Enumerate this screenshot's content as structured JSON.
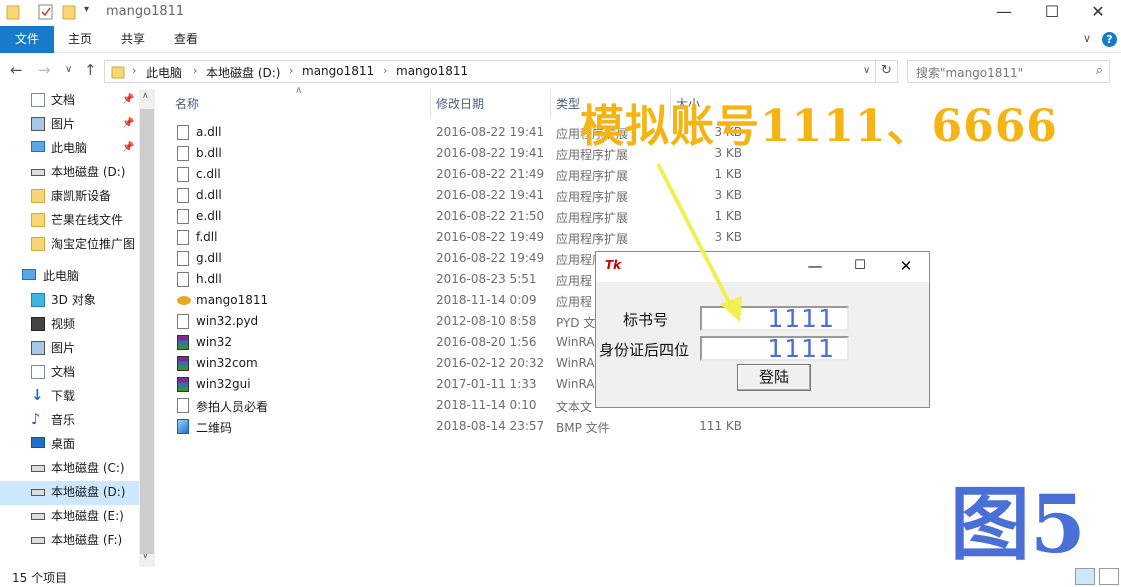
{
  "window": {
    "title": "mango1811"
  },
  "ribbon": {
    "tabs": [
      "文件",
      "主页",
      "共享",
      "查看"
    ]
  },
  "address": {
    "crumbs": [
      "此电脑",
      "本地磁盘 (D:)",
      "mango1811",
      "mango1811"
    ],
    "search_placeholder": "搜索\"mango1811\""
  },
  "nav": {
    "quick": [
      {
        "label": "文档",
        "icon": "document-icon",
        "pinned": true
      },
      {
        "label": "图片",
        "icon": "pictures-icon",
        "pinned": true
      },
      {
        "label": "此电脑",
        "icon": "computer-icon",
        "pinned": true
      },
      {
        "label": "本地磁盘 (D:)",
        "icon": "drive-icon",
        "pinned": false
      },
      {
        "label": "康凯斯设备",
        "icon": "folder-icon",
        "pinned": false
      },
      {
        "label": "芒果在线文件",
        "icon": "folder-icon",
        "pinned": false
      },
      {
        "label": "淘宝定位推广图",
        "icon": "folder-icon",
        "pinned": false
      }
    ],
    "this_pc": "此电脑",
    "pc_items": [
      {
        "label": "3D 对象",
        "icon": "3d-objects-icon"
      },
      {
        "label": "视频",
        "icon": "video-icon"
      },
      {
        "label": "图片",
        "icon": "pictures-icon"
      },
      {
        "label": "文档",
        "icon": "document-icon"
      },
      {
        "label": "下载",
        "icon": "download-icon"
      },
      {
        "label": "音乐",
        "icon": "music-icon"
      },
      {
        "label": "桌面",
        "icon": "desktop-icon"
      },
      {
        "label": "本地磁盘 (C:)",
        "icon": "drive-icon"
      },
      {
        "label": "本地磁盘 (D:)",
        "icon": "drive-icon",
        "selected": true
      },
      {
        "label": "本地磁盘 (E:)",
        "icon": "drive-icon"
      },
      {
        "label": "本地磁盘 (F:)",
        "icon": "drive-icon"
      }
    ]
  },
  "columns": {
    "name": "名称",
    "modified": "修改日期",
    "type": "类型",
    "size": "大小"
  },
  "files": [
    {
      "name": "a.dll",
      "date": "2016-08-22 19:41",
      "type": "应用程序扩展",
      "size": "3 KB",
      "icon": "dll-file-icon"
    },
    {
      "name": "b.dll",
      "date": "2016-08-22 19:41",
      "type": "应用程序扩展",
      "size": "3 KB",
      "icon": "dll-file-icon"
    },
    {
      "name": "c.dll",
      "date": "2016-08-22 21:49",
      "type": "应用程序扩展",
      "size": "1 KB",
      "icon": "dll-file-icon"
    },
    {
      "name": "d.dll",
      "date": "2016-08-22 19:41",
      "type": "应用程序扩展",
      "size": "3 KB",
      "icon": "dll-file-icon"
    },
    {
      "name": "e.dll",
      "date": "2016-08-22 21:50",
      "type": "应用程序扩展",
      "size": "1 KB",
      "icon": "dll-file-icon"
    },
    {
      "name": "f.dll",
      "date": "2016-08-22 19:49",
      "type": "应用程序扩展",
      "size": "3 KB",
      "icon": "dll-file-icon"
    },
    {
      "name": "g.dll",
      "date": "2016-08-22 19:49",
      "type": "应用程序扩展",
      "size": "",
      "icon": "dll-file-icon"
    },
    {
      "name": "h.dll",
      "date": "2016-08-23 5:51",
      "type": "应用程",
      "size": "",
      "icon": "dll-file-icon"
    },
    {
      "name": "mango1811",
      "date": "2018-11-14 0:09",
      "type": "应用程",
      "size": "",
      "icon": "mango-app-icon"
    },
    {
      "name": "win32.pyd",
      "date": "2012-08-10 8:58",
      "type": "PYD 文",
      "size": "",
      "icon": "file-icon"
    },
    {
      "name": "win32",
      "date": "2016-08-20 1:56",
      "type": "WinRA",
      "size": "",
      "icon": "winrar-archive-icon"
    },
    {
      "name": "win32com",
      "date": "2016-02-12 20:32",
      "type": "WinRA",
      "size": "",
      "icon": "winrar-archive-icon"
    },
    {
      "name": "win32gui",
      "date": "2017-01-11 1:33",
      "type": "WinRA",
      "size": "",
      "icon": "winrar-archive-icon"
    },
    {
      "name": "参拍人员必看",
      "date": "2018-11-14 0:10",
      "type": "文本文",
      "size": "",
      "icon": "text-file-icon"
    },
    {
      "name": "二维码",
      "date": "2018-08-14 23:57",
      "type": "BMP 文件",
      "size": "111 KB",
      "icon": "bmp-file-icon"
    }
  ],
  "status": {
    "item_count": "15 个项目"
  },
  "dialog": {
    "icon_text": "Tk",
    "label_bid": "标书号",
    "value_bid": "1111",
    "label_id": "身份证后四位",
    "value_id": "1111",
    "login_label": "登陆"
  },
  "annotation": {
    "text": "模拟账号1111、6666",
    "color": "#f5b414"
  },
  "figure_label": {
    "text": "图5",
    "color": "#4a6fd6"
  },
  "colors": {
    "file_tab": "#1979ca",
    "selected_nav": "#cce8ff"
  }
}
